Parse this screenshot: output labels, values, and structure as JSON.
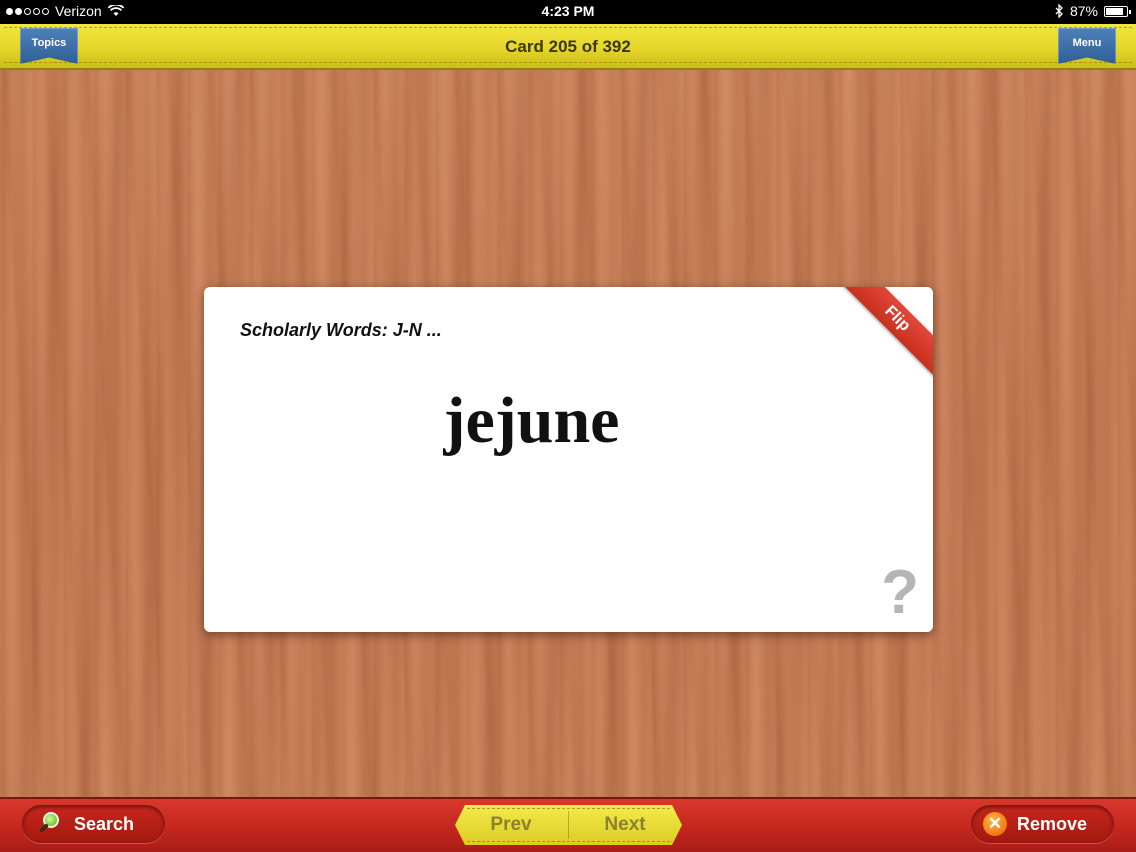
{
  "status_bar": {
    "carrier": "Verizon",
    "time": "4:23 PM",
    "battery_percent": "87%",
    "battery_level": 0.87,
    "signal_bars_on": 2,
    "signal_bars_total": 5,
    "icons": [
      "wifi-icon",
      "bluetooth-icon",
      "battery-icon"
    ]
  },
  "top_bar": {
    "topics_label": "Topics",
    "card_counter": "Card 205 of 392",
    "menu_label": "Menu"
  },
  "card": {
    "topic": "Scholarly Words: J-N ...",
    "word": "jejune",
    "flip_label": "Flip",
    "help_icon": "?"
  },
  "bottom_bar": {
    "search_label": "Search",
    "prev_label": "Prev",
    "next_label": "Next",
    "remove_label": "Remove"
  },
  "colors": {
    "top_bar": "#e5d62a",
    "bottom_bar": "#c82a20",
    "ribbon_blue": "#2f5f98",
    "flip_red": "#d23a2b",
    "wood": "#c47a55"
  }
}
